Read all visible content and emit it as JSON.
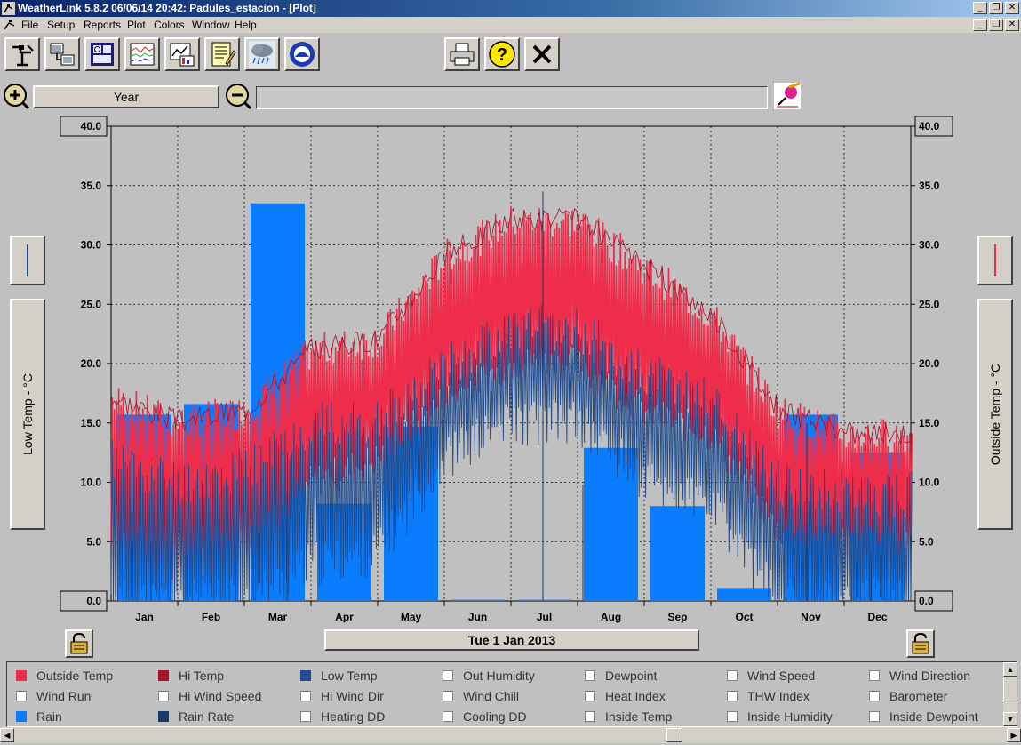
{
  "window": {
    "title": "WeatherLink 5.8.2  06/06/14  20:42: Padules_estacion - [Plot]",
    "controls": [
      "_",
      "❐",
      "✕"
    ]
  },
  "menu": {
    "items": [
      "File",
      "Setup",
      "Reports",
      "Plot",
      "Colors",
      "Window",
      "Help"
    ]
  },
  "toolbar": {
    "buttons": [
      {
        "icon": "weather-station-icon"
      },
      {
        "icon": "connect-station-icon"
      },
      {
        "icon": "bulletin-icon"
      },
      {
        "icon": "strip-chart-icon"
      },
      {
        "icon": "plot-icon"
      },
      {
        "icon": "notes-icon"
      },
      {
        "icon": "rain-cloud-icon"
      },
      {
        "icon": "noaa-icon"
      },
      {
        "icon": "printer-icon"
      },
      {
        "icon": "help-icon"
      },
      {
        "icon": "close-icon"
      }
    ]
  },
  "range": {
    "period_label": "Year",
    "field_value": ""
  },
  "plot": {
    "left_axis_label": "Low Temp - °C",
    "right_axis_label": "Outside Temp - °C",
    "date_label": "Tue 1 Jan 2013",
    "left_series_color": "#1f4b8c",
    "right_series_color": "#ee2d4b"
  },
  "chart_data": {
    "type": "bar",
    "categories": [
      "Jan",
      "Feb",
      "Mar",
      "Apr",
      "May",
      "Jun",
      "Jul",
      "Aug",
      "Sep",
      "Oct",
      "Nov",
      "Dec"
    ],
    "ylim": [
      0,
      40
    ],
    "yticks": [
      "0.0",
      "5.0",
      "10.0",
      "15.0",
      "20.0",
      "25.0",
      "30.0",
      "35.0",
      "40.0"
    ],
    "grid": true,
    "series": [
      {
        "name": "Rain",
        "type": "bar",
        "color": "#0a7dff",
        "values": [
          15.7,
          16.6,
          33.5,
          8.2,
          14.7,
          0.1,
          0.1,
          12.9,
          8.0,
          1.1,
          15.7,
          12.5
        ]
      },
      {
        "name": "Outside Temp",
        "type": "line",
        "color": "#ee2d4b",
        "monthly_high": [
          17,
          15,
          16,
          21,
          22,
          29,
          32,
          32,
          28,
          24,
          16,
          14
        ],
        "monthly_low": [
          5,
          3,
          5,
          10,
          12,
          17,
          20,
          20,
          16,
          14,
          6,
          5
        ]
      },
      {
        "name": "Low Temp",
        "type": "line",
        "color": "#1f4b8c",
        "monthly_high": [
          12,
          10,
          11,
          15,
          15,
          20,
          23,
          23,
          19,
          17,
          10,
          9
        ],
        "monthly_low": [
          0,
          0,
          0,
          3,
          4,
          12,
          15,
          15,
          10,
          8,
          0,
          0
        ]
      }
    ]
  },
  "legend": {
    "items": [
      {
        "label": "Outside Temp",
        "checked": true,
        "color": "#ee2d4b"
      },
      {
        "label": "Hi Temp",
        "checked": true,
        "color": "#a5102a"
      },
      {
        "label": "Low Temp",
        "checked": true,
        "color": "#1f4b8c"
      },
      {
        "label": "Out Humidity",
        "checked": false,
        "color": ""
      },
      {
        "label": "Dewpoint",
        "checked": false,
        "color": ""
      },
      {
        "label": "Wind Speed",
        "checked": false,
        "color": ""
      },
      {
        "label": "Wind Direction",
        "checked": false,
        "color": ""
      },
      {
        "label": "Wind Run",
        "checked": false,
        "color": ""
      },
      {
        "label": "Hi Wind Speed",
        "checked": false,
        "color": ""
      },
      {
        "label": "Hi Wind Dir",
        "checked": false,
        "color": ""
      },
      {
        "label": "Wind Chill",
        "checked": false,
        "color": ""
      },
      {
        "label": "Heat Index",
        "checked": false,
        "color": ""
      },
      {
        "label": "THW Index",
        "checked": false,
        "color": ""
      },
      {
        "label": "Barometer",
        "checked": false,
        "color": ""
      },
      {
        "label": "Rain",
        "checked": true,
        "color": "#0a7dff"
      },
      {
        "label": "Rain Rate",
        "checked": true,
        "color": "#1a3a6b"
      },
      {
        "label": "Heating DD",
        "checked": false,
        "color": ""
      },
      {
        "label": "Cooling DD",
        "checked": false,
        "color": ""
      },
      {
        "label": "Inside Temp",
        "checked": false,
        "color": ""
      },
      {
        "label": "Inside Humidity",
        "checked": false,
        "color": ""
      },
      {
        "label": "Inside Dewpoint",
        "checked": false,
        "color": ""
      }
    ]
  }
}
